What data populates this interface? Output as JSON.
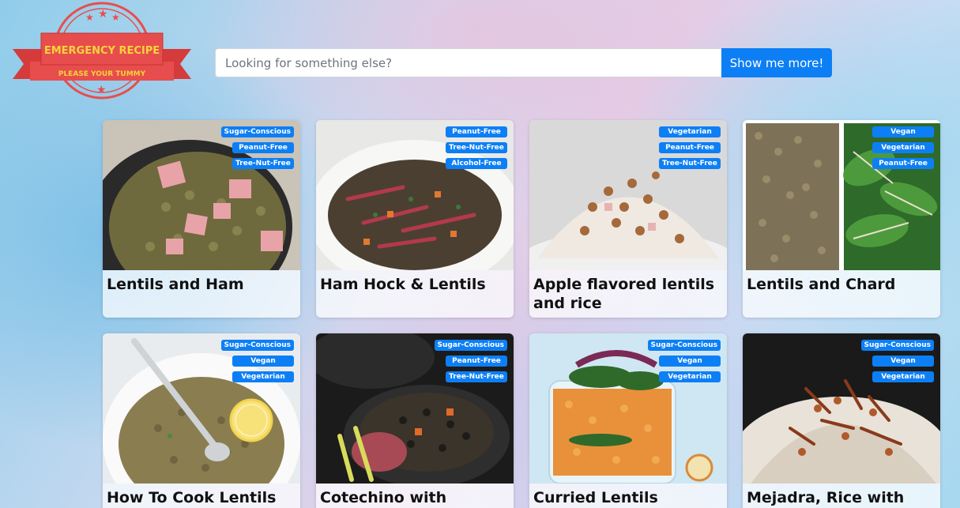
{
  "logo": {
    "title": "EMERGENCY RECIPE",
    "tagline": "PLEASE YOUR TUMMY"
  },
  "search": {
    "placeholder": "Looking for something else?",
    "button_label": "Show me more!"
  },
  "recipes": [
    {
      "title": "Lentils and Ham",
      "labels": [
        "Sugar-Conscious",
        "Peanut-Free",
        "Tree-Nut-Free"
      ]
    },
    {
      "title": "Ham Hock & Lentils",
      "labels": [
        "Peanut-Free",
        "Tree-Nut-Free",
        "Alcohol-Free"
      ]
    },
    {
      "title": "Apple flavored lentils and rice",
      "labels": [
        "Vegetarian",
        "Peanut-Free",
        "Tree-Nut-Free"
      ]
    },
    {
      "title": "Lentils and Chard",
      "labels": [
        "Vegan",
        "Vegetarian",
        "Peanut-Free"
      ]
    },
    {
      "title": "How To Cook Lentils On",
      "labels": [
        "Sugar-Conscious",
        "Vegan",
        "Vegetarian"
      ]
    },
    {
      "title": "Cotechino with Beluga",
      "labels": [
        "Sugar-Conscious",
        "Peanut-Free",
        "Tree-Nut-Free"
      ]
    },
    {
      "title": "Curried Lentils",
      "labels": [
        "Sugar-Conscious",
        "Vegan",
        "Vegetarian"
      ]
    },
    {
      "title": "Mejadra, Rice with",
      "labels": [
        "Sugar-Conscious",
        "Vegan",
        "Vegetarian"
      ]
    }
  ],
  "colors": {
    "accent": "#0d7ff5",
    "logo_red": "#e84d4d",
    "logo_yellow": "#f5d33a"
  }
}
